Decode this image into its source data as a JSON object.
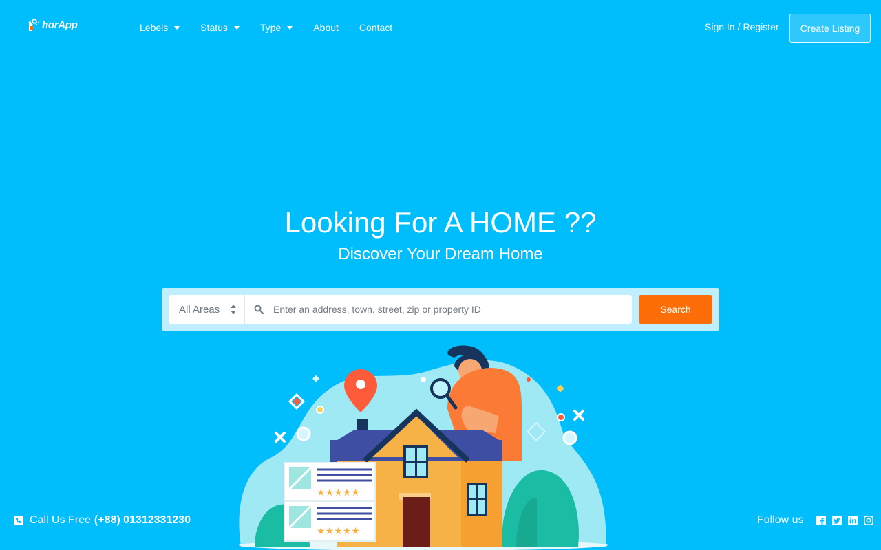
{
  "brand": {
    "name": "horApp"
  },
  "nav": {
    "items": [
      {
        "label": "Lebels",
        "dropdown": true
      },
      {
        "label": "Status",
        "dropdown": true
      },
      {
        "label": "Type",
        "dropdown": true
      },
      {
        "label": "About",
        "dropdown": false
      },
      {
        "label": "Contact",
        "dropdown": false
      }
    ]
  },
  "auth": {
    "sign_in": "Sign In",
    "separator": "/",
    "register": "Register"
  },
  "header": {
    "create_listing": "Create Listing"
  },
  "hero": {
    "title": "Looking For A HOME ??",
    "subtitle": "Discover Your Dream Home"
  },
  "search": {
    "area_selected": "All Areas",
    "placeholder": "Enter an address, town, street, zip or property ID",
    "value": "",
    "button": "Search"
  },
  "footer": {
    "call_label": "Call Us Free",
    "phone": "(+88) 01312331230",
    "follow_label": "Follow us",
    "social_icons": [
      "facebook-icon",
      "twitter-icon",
      "linkedin-icon",
      "instagram-icon"
    ]
  },
  "colors": {
    "background": "#00bdfc",
    "search_button": "#fd6d08",
    "search_panel": "#bfeefe"
  }
}
